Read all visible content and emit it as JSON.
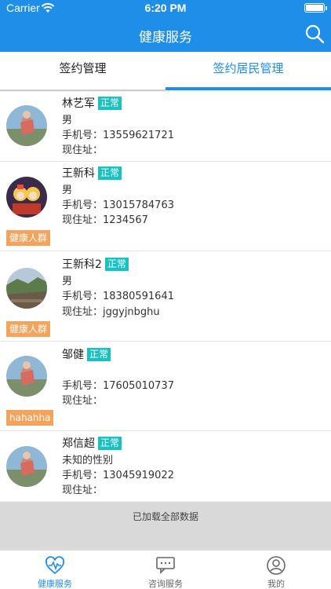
{
  "status": {
    "carrier": "Carrier",
    "time": "6:20 PM"
  },
  "header": {
    "title": "健康服务"
  },
  "tabs": [
    {
      "label": "签约管理"
    },
    {
      "label": "签约居民管理"
    }
  ],
  "residents": [
    {
      "name": "林艺军",
      "status": "正常",
      "gender": "男",
      "phone_label": "手机号：",
      "phone": "13559621721",
      "address_label": "现住址：",
      "address": "",
      "tag": ""
    },
    {
      "name": "王新科",
      "status": "正常",
      "gender": "男",
      "phone_label": "手机号：",
      "phone": "13015784763",
      "address_label": "现住址：",
      "address": "1234567",
      "tag": "健康人群"
    },
    {
      "name": "王新科2",
      "status": "正常",
      "gender": "男",
      "phone_label": "手机号：",
      "phone": "18380591641",
      "address_label": "现住址：",
      "address": "jggyjnbghu",
      "tag": "健康人群"
    },
    {
      "name": "邹健",
      "status": "正常",
      "gender": "",
      "phone_label": "手机号：",
      "phone": "17605010737",
      "address_label": "现住址：",
      "address": "",
      "tag": "hahahha"
    },
    {
      "name": "郑信超",
      "status": "正常",
      "gender": "未知的性别",
      "phone_label": "手机号：",
      "phone": "13045919022",
      "address_label": "现住址：",
      "address": "",
      "tag": ""
    }
  ],
  "list_footer": "已加载全部数据",
  "tabbar": [
    {
      "label": "健康服务",
      "icon": "heart-pulse-icon"
    },
    {
      "label": "咨询服务",
      "icon": "chat-icon"
    },
    {
      "label": "我的",
      "icon": "person-icon"
    }
  ],
  "colors": {
    "primary": "#1e8ee9",
    "badge": "#18c2c2",
    "tag": "#f4a35d"
  }
}
